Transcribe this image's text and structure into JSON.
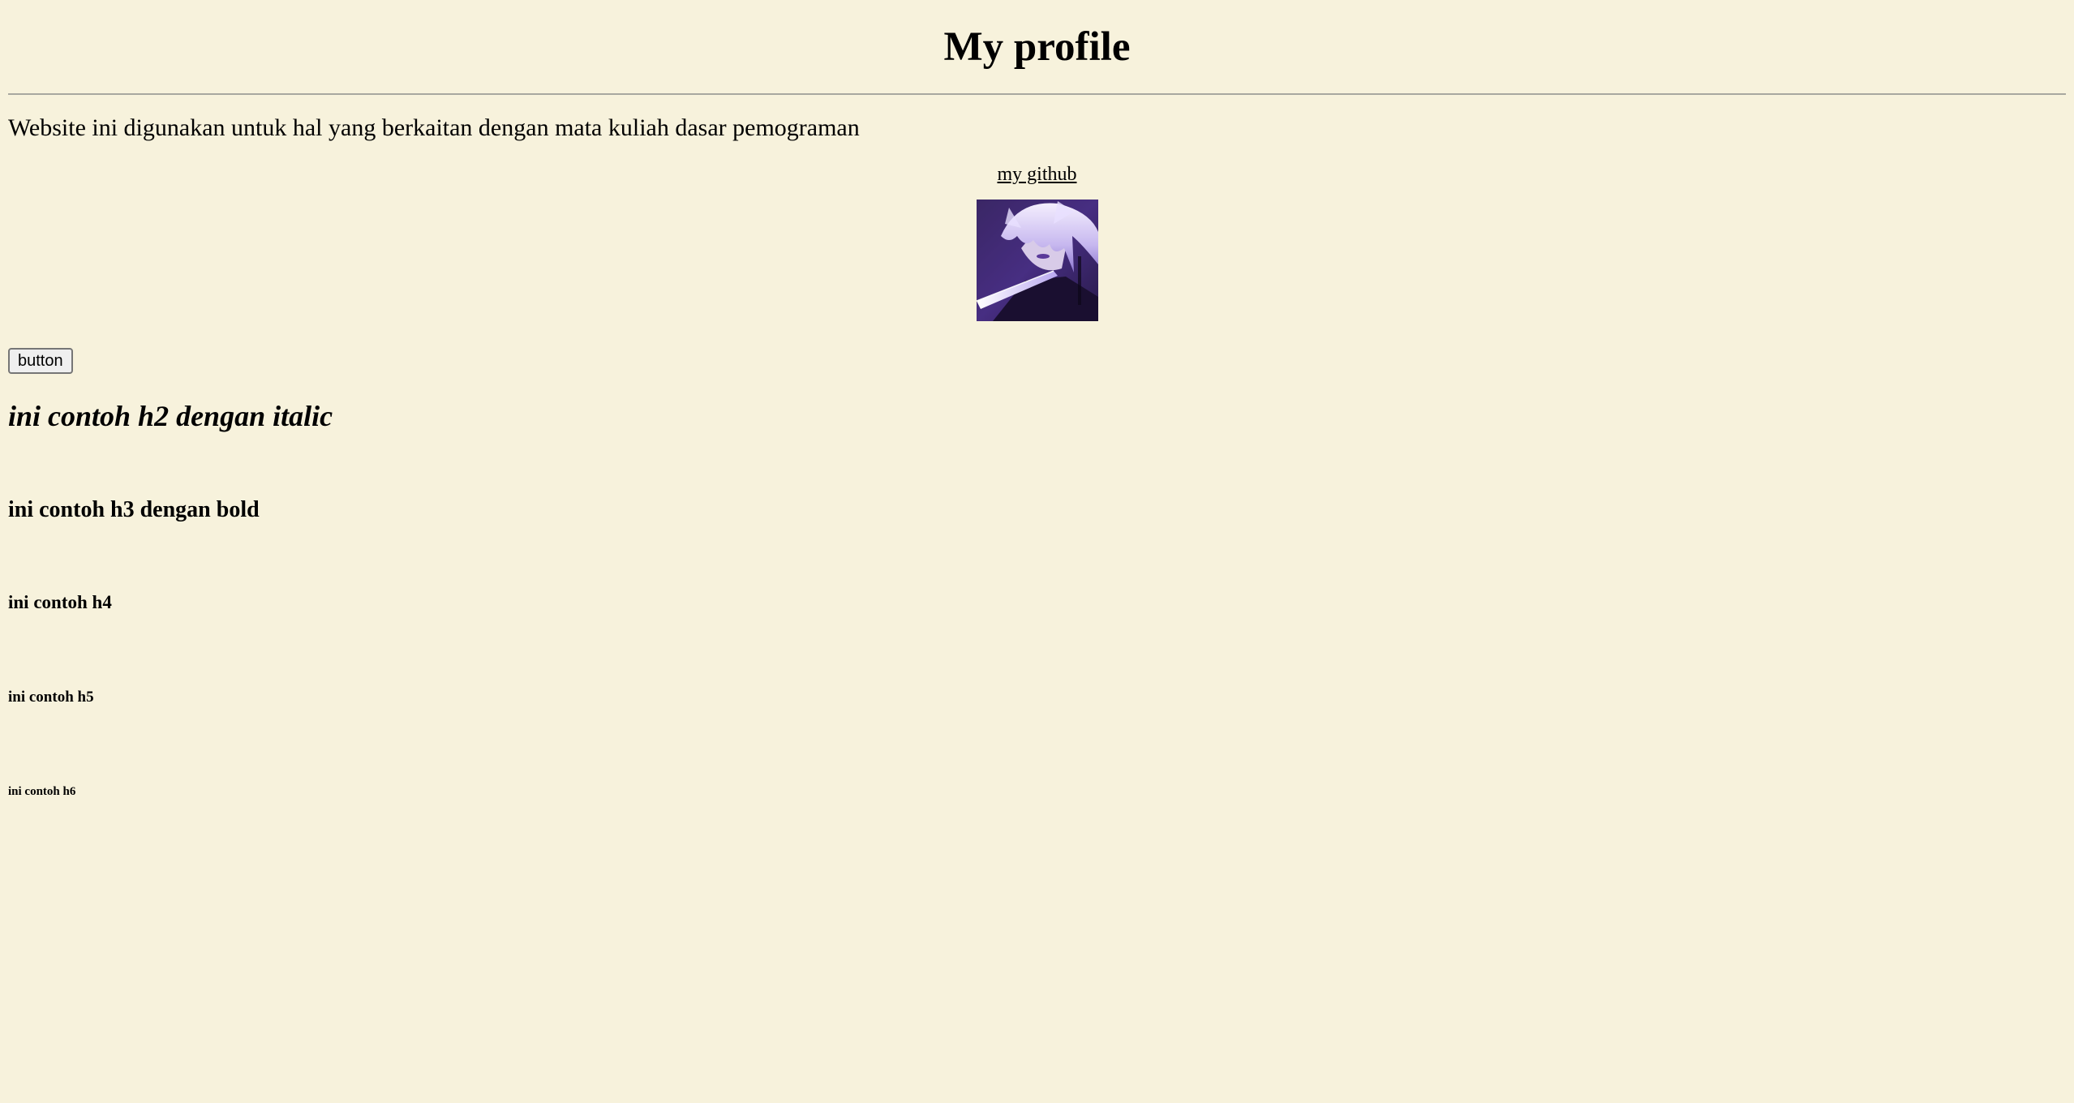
{
  "header": {
    "title": "My profile"
  },
  "intro": {
    "description": "Website ini digunakan untuk hal yang berkaitan dengan mata kuliah dasar pemograman"
  },
  "links": {
    "github_label": "my github"
  },
  "profile_image": {
    "icon": "anime-avatar-image"
  },
  "actions": {
    "button_label": "button"
  },
  "headings": {
    "h2": "ini contoh h2 dengan italic",
    "h3": "ini contoh h3 dengan bold",
    "h4": "ini contoh h4",
    "h5": "ini contoh h5",
    "h6": "ini contoh h6"
  },
  "colors": {
    "background": "#f7f2dc",
    "text": "#000000",
    "divider": "#a8a8a0"
  }
}
